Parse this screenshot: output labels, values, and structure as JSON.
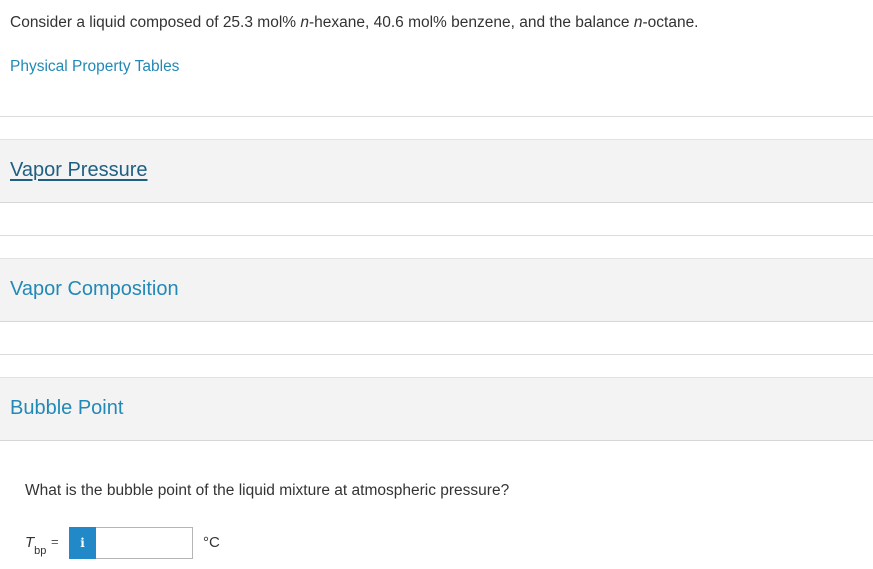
{
  "intro": {
    "part1": "Consider a liquid composed of 25.3 mol% ",
    "italic1": "n",
    "part2": "-hexane, 40.6 mol% benzene, and the balance ",
    "italic2": "n",
    "part3": "-octane."
  },
  "links": {
    "physical_property_tables": "Physical Property Tables"
  },
  "sections": [
    {
      "title": "Vapor Pressure"
    },
    {
      "title": "Vapor Composition"
    },
    {
      "title": "Bubble Point"
    }
  ],
  "question": {
    "text": "What is the bubble point of the liquid mixture at atmospheric pressure?",
    "variable": "T",
    "variable_sub": "bp",
    "equals": "=",
    "info_label": "i",
    "input_value": "",
    "unit": "°C"
  },
  "colors": {
    "link": "#2289b7",
    "active_section": "#1f5f82",
    "info_button": "#2289c9",
    "section_bg": "#f3f3f3"
  }
}
